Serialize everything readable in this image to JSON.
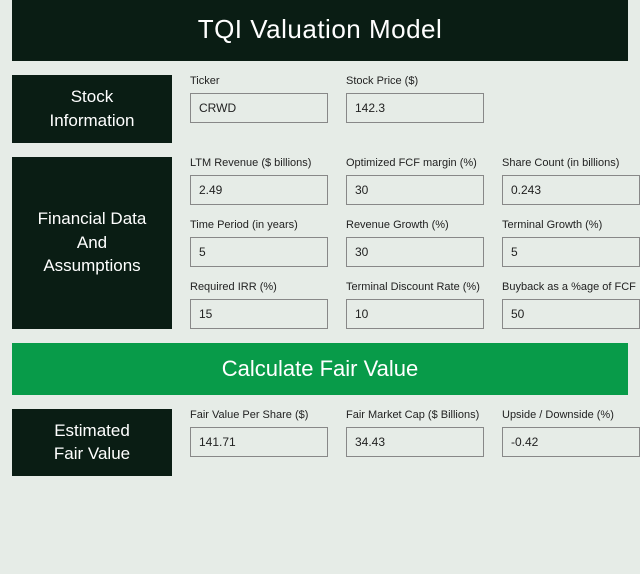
{
  "title": "TQI Valuation Model",
  "sections": {
    "stockInfo": {
      "label": "Stock\nInformation",
      "fields": [
        {
          "label": "Ticker",
          "value": "CRWD"
        },
        {
          "label": "Stock Price ($)",
          "value": "142.3"
        }
      ]
    },
    "financial": {
      "label": "Financial Data\nAnd\nAssumptions",
      "rows": [
        [
          {
            "label": "LTM Revenue ($ billions)",
            "value": "2.49"
          },
          {
            "label": "Optimized FCF margin (%)",
            "value": "30"
          },
          {
            "label": "Share Count (in billions)",
            "value": "0.243"
          }
        ],
        [
          {
            "label": "Time Period (in years)",
            "value": "5"
          },
          {
            "label": "Revenue Growth (%)",
            "value": "30"
          },
          {
            "label": "Terminal Growth (%)",
            "value": "5"
          }
        ],
        [
          {
            "label": "Required IRR (%)",
            "value": "15"
          },
          {
            "label": "Terminal Discount Rate (%)",
            "value": "10"
          },
          {
            "label": "Buyback as a %age of FCF",
            "value": "50"
          }
        ]
      ]
    },
    "calcButton": "Calculate Fair Value",
    "estimated": {
      "label": "Estimated\nFair Value",
      "fields": [
        {
          "label": "Fair Value Per Share ($)",
          "value": "141.71"
        },
        {
          "label": "Fair Market Cap ($ Billions)",
          "value": "34.43"
        },
        {
          "label": "Upside / Downside (%)",
          "value": "-0.42"
        }
      ]
    }
  }
}
